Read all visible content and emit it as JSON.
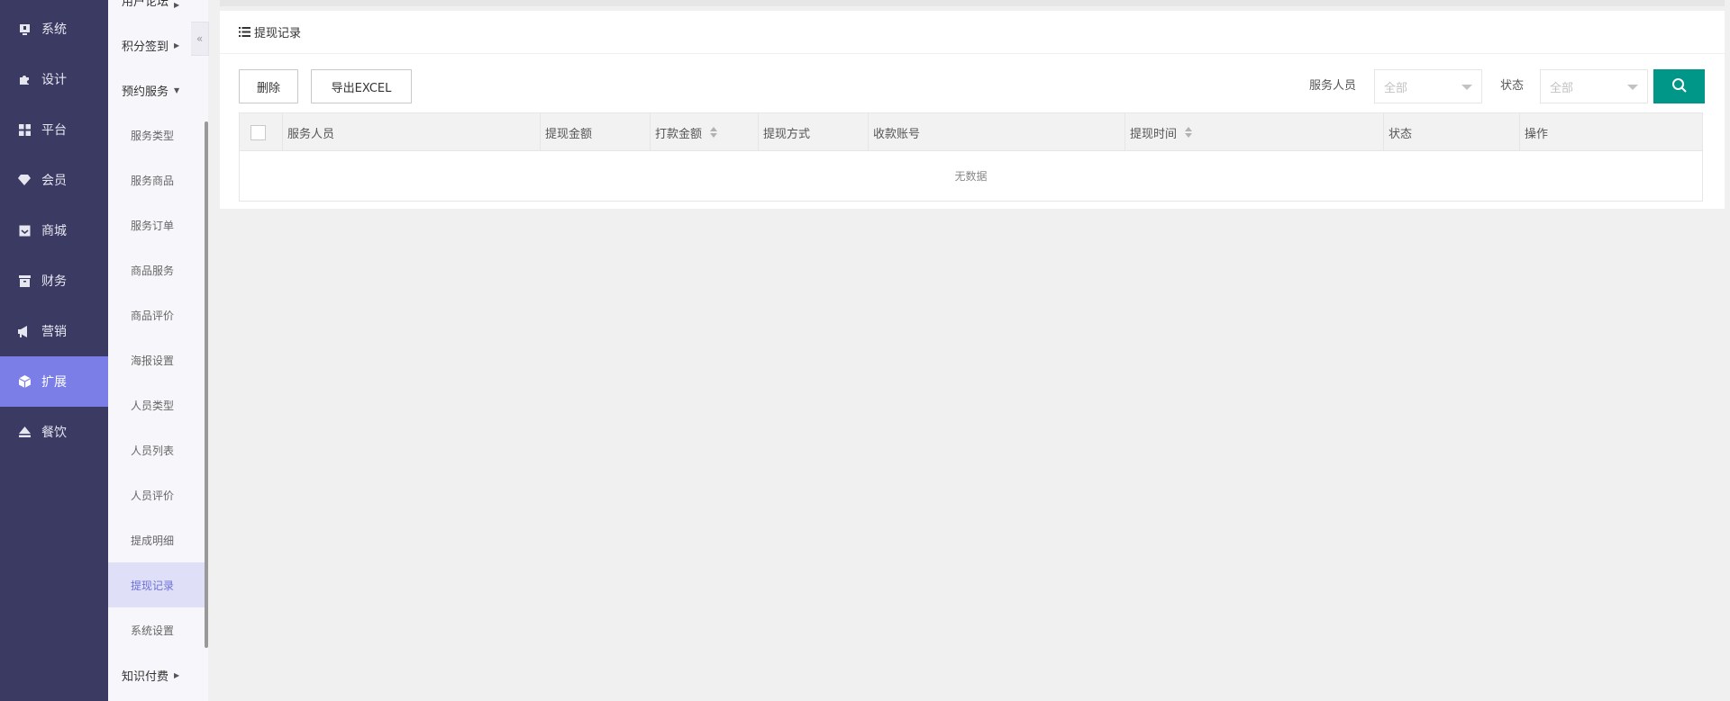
{
  "main_nav": [
    {
      "label": "系统",
      "icon": "monitor-icon"
    },
    {
      "label": "设计",
      "icon": "puzzle-icon"
    },
    {
      "label": "平台",
      "icon": "grid-icon"
    },
    {
      "label": "会员",
      "icon": "diamond-icon"
    },
    {
      "label": "商城",
      "icon": "inbox-icon"
    },
    {
      "label": "财务",
      "icon": "archive-icon"
    },
    {
      "label": "营销",
      "icon": "megaphone-icon"
    },
    {
      "label": "扩展",
      "icon": "cube-icon"
    },
    {
      "label": "餐饮",
      "icon": "eject-icon"
    }
  ],
  "active_main": "扩展",
  "sub_nav": {
    "groups_top": [
      "用户论坛",
      "积分签到",
      "预约服务"
    ],
    "leaves": [
      "服务类型",
      "服务商品",
      "服务订单",
      "商品服务",
      "商品评价",
      "海报设置",
      "人员类型",
      "人员列表",
      "人员评价",
      "提成明细",
      "提现记录",
      "系统设置"
    ],
    "active_leaf": "提现记录",
    "groups_bottom": [
      "知识付费"
    ]
  },
  "panel": {
    "title": "提现记录"
  },
  "toolbar": {
    "delete_label": "删除",
    "export_label": "导出EXCEL",
    "staff_filter_label": "服务人员",
    "staff_filter_value": "全部",
    "status_filter_label": "状态",
    "status_filter_value": "全部"
  },
  "table": {
    "columns": [
      "服务人员",
      "提现金额",
      "打款金额",
      "提现方式",
      "收款账号",
      "提现时间",
      "状态",
      "操作"
    ],
    "sortable_columns": [
      "打款金额",
      "提现时间"
    ],
    "empty_text": "无数据"
  },
  "colors": {
    "sidebar_bg": "#3b3a63",
    "active_nav": "#7b7ee6",
    "search_button": "#009688"
  }
}
